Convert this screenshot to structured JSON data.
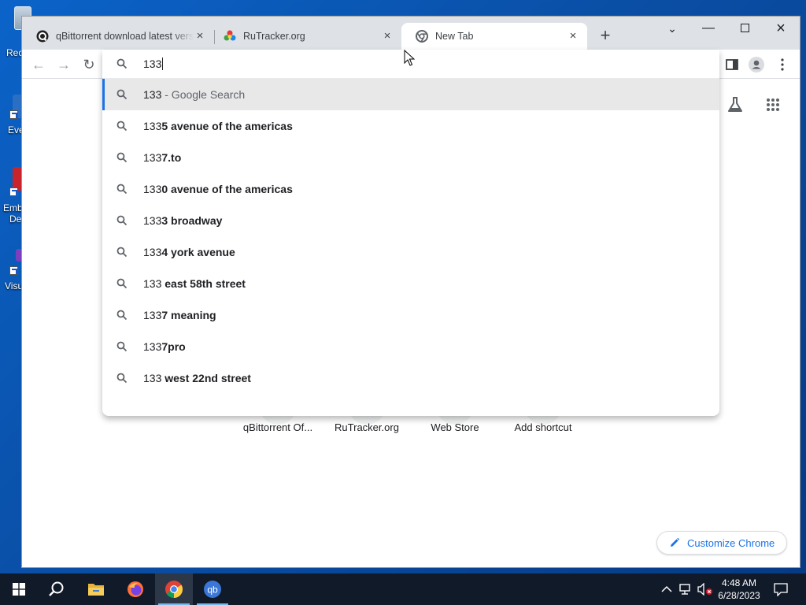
{
  "desktop": {
    "icons": [
      {
        "label": "Rec"
      },
      {
        "label": "Eve"
      },
      {
        "label": "Emb"
      },
      {
        "label": "De"
      },
      {
        "label": "Visu"
      }
    ]
  },
  "tabs": [
    {
      "title": "qBittorrent download latest vers",
      "active": false
    },
    {
      "title": "RuTracker.org",
      "active": false
    },
    {
      "title": "New Tab",
      "active": true
    }
  ],
  "omnibox": {
    "query": "133",
    "suggestions": [
      {
        "typed": "133",
        "rest": "",
        "suffix": " - Google Search",
        "selected": true
      },
      {
        "typed": "133",
        "rest": "5 avenue of the americas",
        "suffix": ""
      },
      {
        "typed": "133",
        "rest": "7.to",
        "suffix": ""
      },
      {
        "typed": "133",
        "rest": "0 avenue of the americas",
        "suffix": ""
      },
      {
        "typed": "133",
        "rest": "3 broadway",
        "suffix": ""
      },
      {
        "typed": "133",
        "rest": "4 york avenue",
        "suffix": ""
      },
      {
        "typed": "133",
        "rest": " east 58th street",
        "suffix": ""
      },
      {
        "typed": "133",
        "rest": "7 meaning",
        "suffix": ""
      },
      {
        "typed": "133",
        "rest": "7pro",
        "suffix": ""
      },
      {
        "typed": "133",
        "rest": " west 22nd street",
        "suffix": ""
      }
    ]
  },
  "ntp": {
    "shortcuts": [
      {
        "label": "qBittorrent Of..."
      },
      {
        "label": "RuTracker.org"
      },
      {
        "label": "Web Store"
      },
      {
        "label": "Add shortcut"
      }
    ],
    "customize_label": "Customize Chrome"
  },
  "taskbar": {
    "apps": [
      "start-icon",
      "search-icon",
      "file-explorer-icon",
      "firefox-icon",
      "chrome-icon",
      "qbittorrent-icon"
    ],
    "clock_time": "4:48 AM",
    "clock_date": "6/28/2023"
  },
  "colors": {
    "accent": "#1a73e8",
    "titlebar": "#dee1e6",
    "taskbar": "#111a29"
  }
}
